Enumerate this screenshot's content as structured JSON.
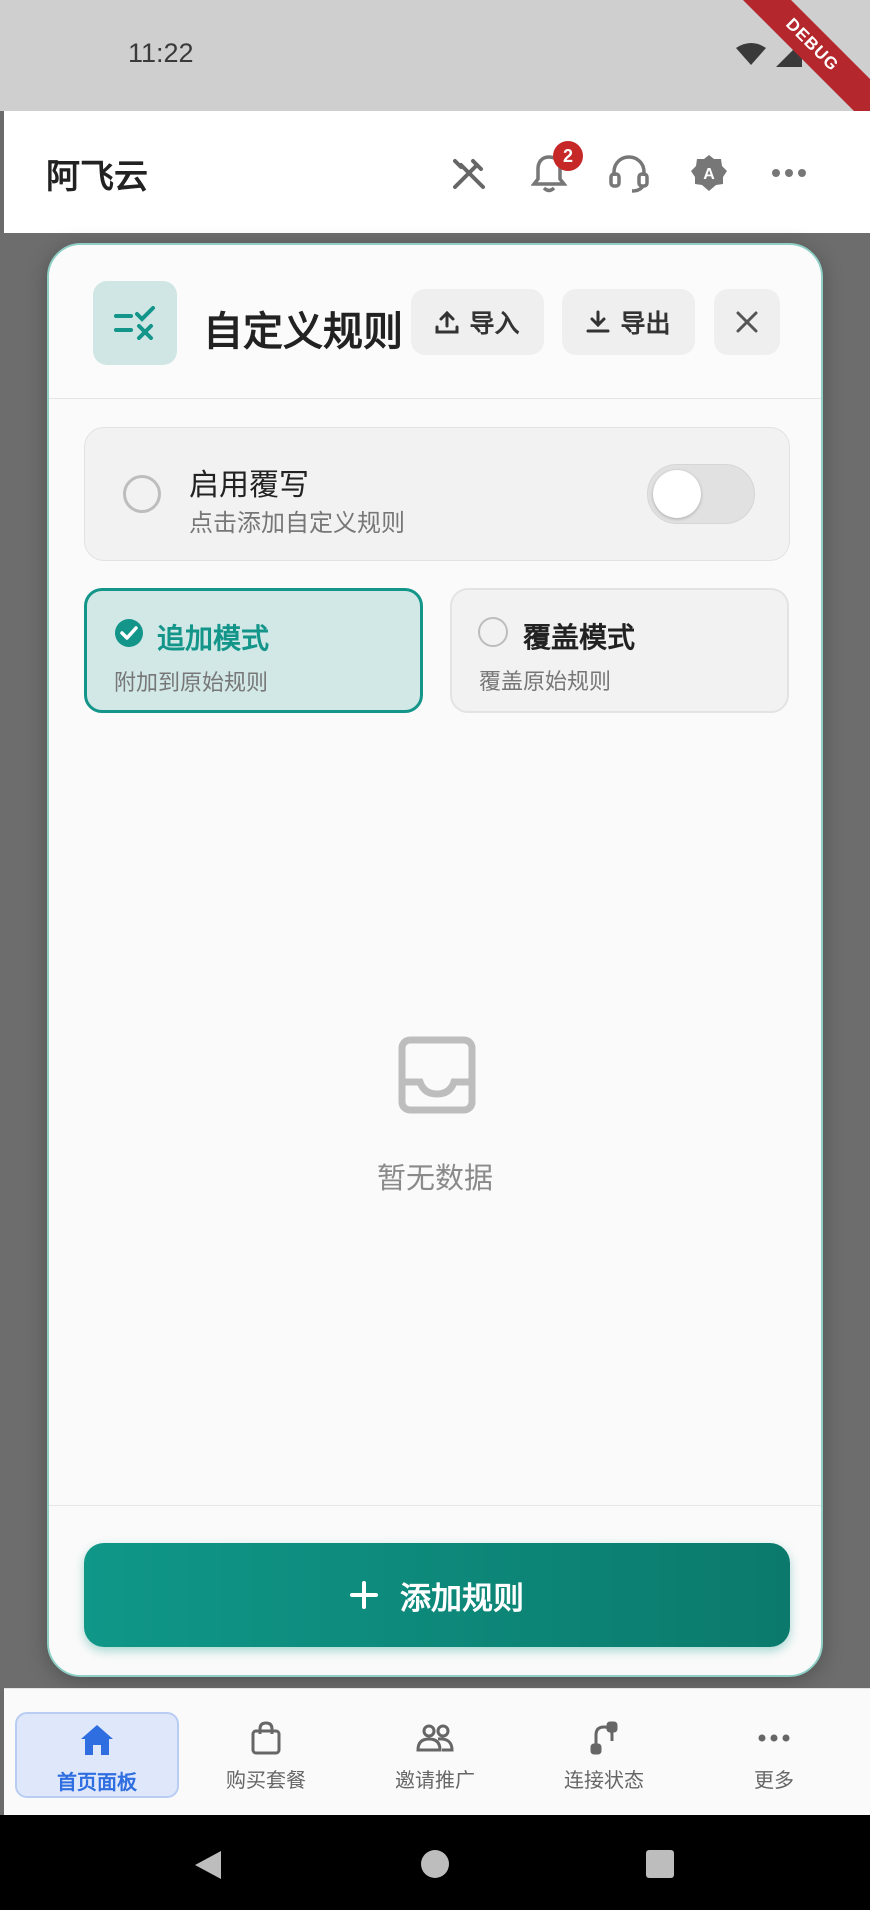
{
  "status_bar": {
    "time": "11:22",
    "debug_label": "DEBUG"
  },
  "app_bar": {
    "title": "阿飞云",
    "notification_count": "2",
    "icons": [
      "tools-icon",
      "bell-icon",
      "headset-icon",
      "account-badge-icon",
      "more-icon"
    ]
  },
  "dialog": {
    "title": "自定义规则",
    "import_label": "导入",
    "export_label": "导出",
    "enable": {
      "title": "启用覆写",
      "subtitle": "点击添加自定义规则",
      "toggle_on": false
    },
    "modes": [
      {
        "title": "追加模式",
        "subtitle": "附加到原始规则",
        "selected": true
      },
      {
        "title": "覆盖模式",
        "subtitle": "覆盖原始规则",
        "selected": false
      }
    ],
    "empty_text": "暂无数据",
    "add_button_label": "添加规则",
    "colors": {
      "accent": "#14958a",
      "accent_bg": "#d1e8e6",
      "button": "#0f9788"
    }
  },
  "bottom_nav": {
    "items": [
      {
        "label": "首页面板",
        "icon": "home-icon",
        "active": true
      },
      {
        "label": "购买套餐",
        "icon": "shopping-bag-icon",
        "active": false
      },
      {
        "label": "邀请推广",
        "icon": "group-icon",
        "active": false
      },
      {
        "label": "连接状态",
        "icon": "route-icon",
        "active": false
      },
      {
        "label": "更多",
        "icon": "more-icon",
        "active": false
      }
    ]
  }
}
